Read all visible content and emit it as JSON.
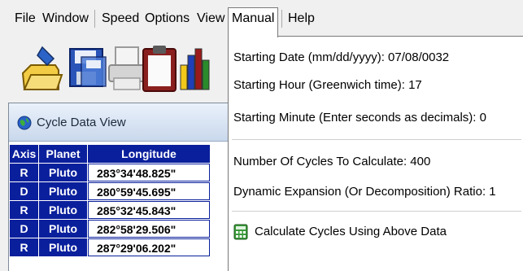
{
  "menubar": {
    "items": [
      "File",
      "Window",
      "Speed",
      "Options",
      "View",
      "Manual",
      "Help"
    ]
  },
  "toolbar": {
    "buttons": [
      "open-folder-icon",
      "save-disk-icon",
      "print-icon",
      "clipboard-icon",
      "chart-icon"
    ]
  },
  "child_window": {
    "title": "Cycle Data View",
    "columns": [
      "Axis",
      "Planet",
      "Longitude"
    ],
    "rows": [
      {
        "axis": "R",
        "planet": "Pluto",
        "longitude": "283°34'48.825\""
      },
      {
        "axis": "D",
        "planet": "Pluto",
        "longitude": "280°59'45.695\""
      },
      {
        "axis": "R",
        "planet": "Pluto",
        "longitude": "285°32'45.843\""
      },
      {
        "axis": "D",
        "planet": "Pluto",
        "longitude": "282°58'29.506\""
      },
      {
        "axis": "R",
        "planet": "Pluto",
        "longitude": "287°29'06.202\""
      }
    ]
  },
  "manual_menu": {
    "items": [
      {
        "label": "Starting Date (mm/dd/yyyy): 07/08/0032"
      },
      {
        "label": "Starting Hour (Greenwich time): 17"
      },
      {
        "label": "Starting Minute (Enter seconds as decimals): 0"
      },
      {
        "label": "Number Of Cycles To Calculate: 400"
      },
      {
        "label": "Dynamic Expansion (Or Decomposition) Ratio: 1"
      },
      {
        "label": "Calculate Cycles Using  Above Data"
      }
    ]
  },
  "colors": {
    "grid_header": "#0a1f9c",
    "menu_background": "#ffffff"
  }
}
